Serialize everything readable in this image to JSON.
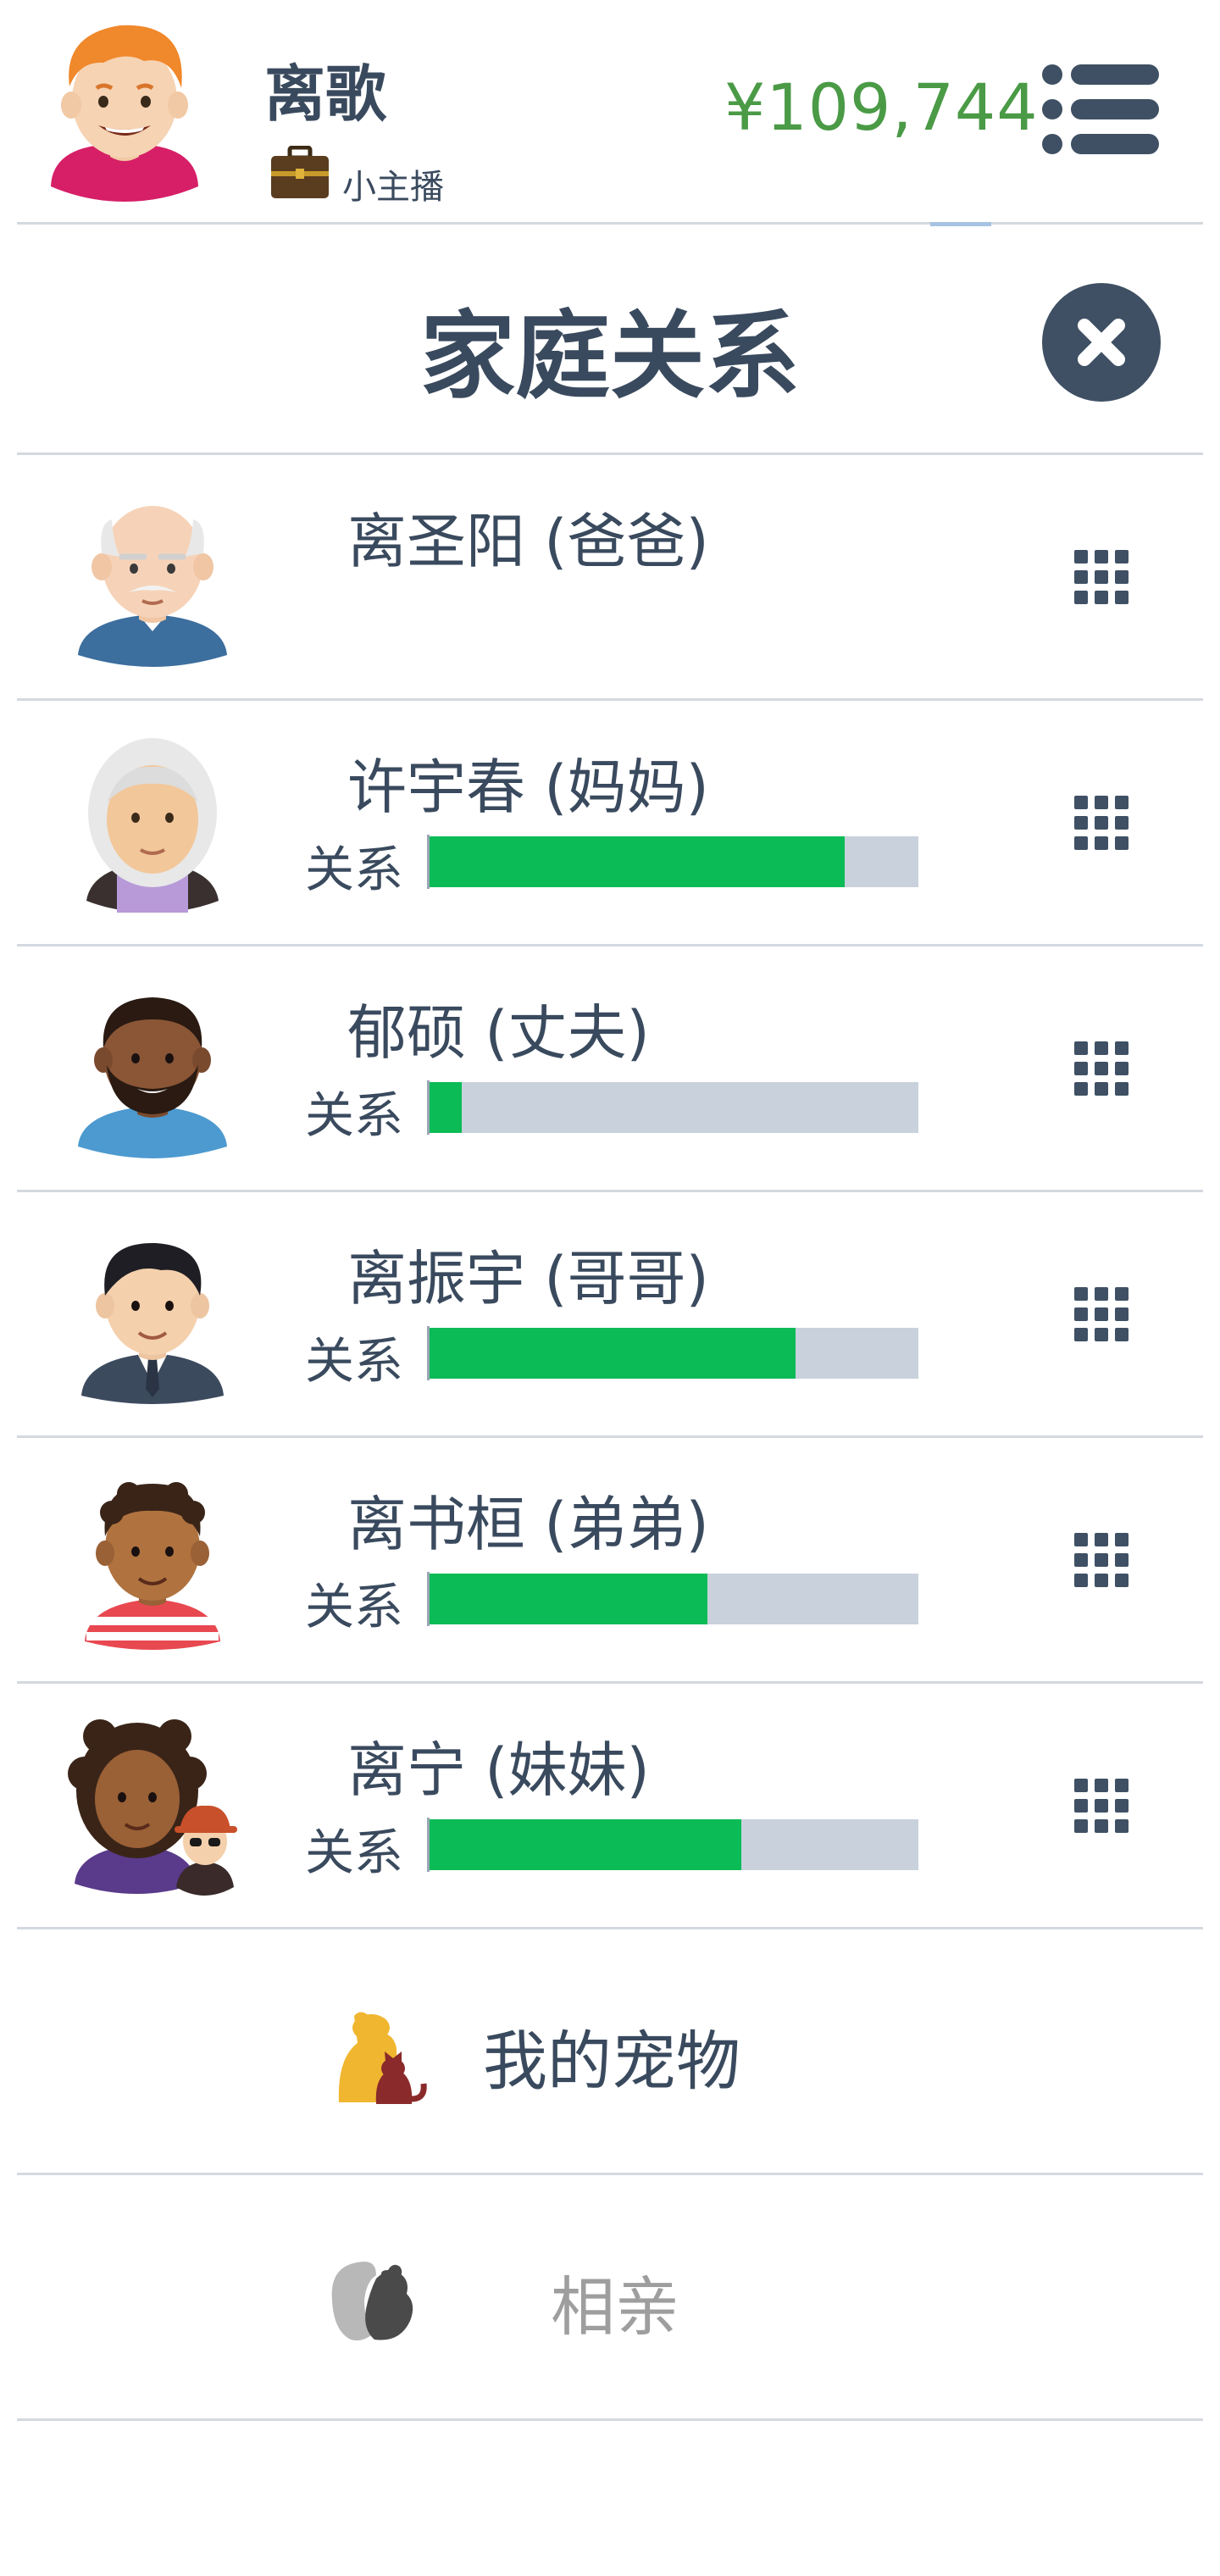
{
  "header": {
    "player_name": "离歌",
    "job_title": "小主播",
    "money": "¥109,744"
  },
  "page": {
    "title": "家庭关系"
  },
  "family": [
    {
      "name": "离圣阳 (爸爸)",
      "avatar": "old-man-avatar",
      "relationship_label": "",
      "relationship": null
    },
    {
      "name": "许宇春 (妈妈)",
      "avatar": "old-woman-avatar",
      "relationship_label": "关系",
      "relationship": 0.85
    },
    {
      "name": "郁硕 (丈夫)",
      "avatar": "bearded-man-avatar",
      "relationship_label": "关系",
      "relationship": 0.07
    },
    {
      "name": "离振宇 (哥哥)",
      "avatar": "man-in-suit-avatar",
      "relationship_label": "关系",
      "relationship": 0.75
    },
    {
      "name": "离书桓 (弟弟)",
      "avatar": "curly-hair-boy-avatar",
      "relationship_label": "关系",
      "relationship": 0.57
    },
    {
      "name": "离宁 (妹妹)",
      "avatar": "girl-and-child-avatar",
      "relationship_label": "关系",
      "relationship": 0.64
    }
  ],
  "bottom_menu": {
    "pets_label": "我的宠物",
    "dating_label": "相亲"
  },
  "colors": {
    "text": "#3a4a5e",
    "money": "#4a9a46",
    "bar_fill": "#0bbb55",
    "bar_track": "#c8d1dc",
    "divider": "#d4d9e0",
    "disabled_text": "#9e9e9e"
  },
  "icons": {
    "menu": "menu-icon",
    "close": "close-icon",
    "member_actions": "grid-icon",
    "job": "briefcase-icon",
    "pets": "dog-cat-icon",
    "dating": "couple-heart-icon"
  }
}
